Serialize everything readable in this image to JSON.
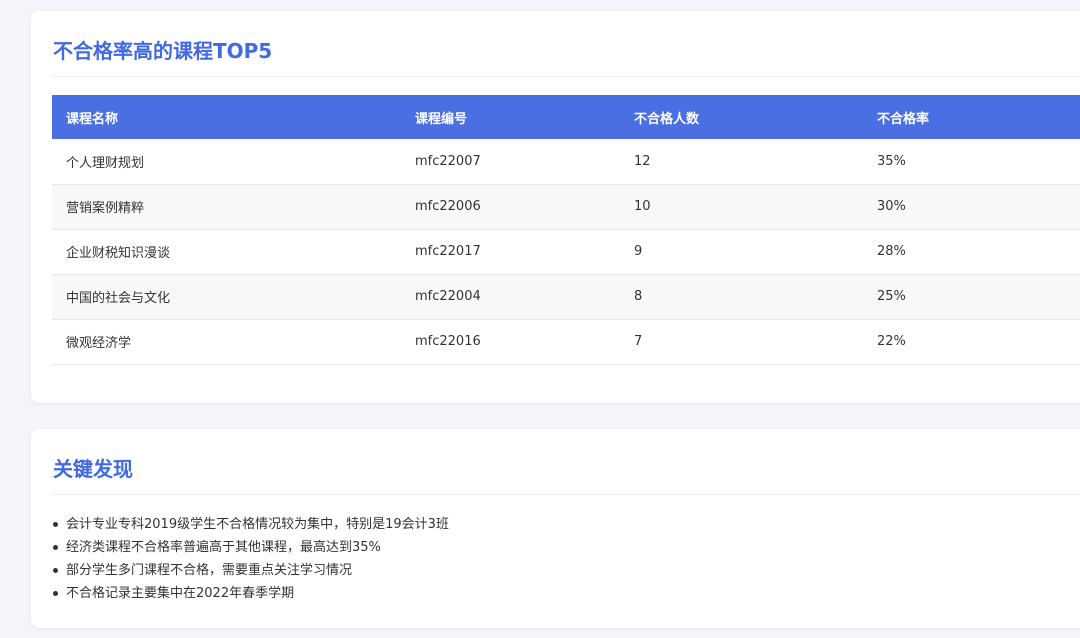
{
  "top_courses": {
    "title": "不合格率高的课程TOP5",
    "columns": [
      "课程名称",
      "课程编号",
      "不合格人数",
      "不合格率"
    ],
    "rows": [
      [
        "个人理财规划",
        "mfc22007",
        "12",
        "35%"
      ],
      [
        "营销案例精粹",
        "mfc22006",
        "10",
        "30%"
      ],
      [
        "企业财税知识漫谈",
        "mfc22017",
        "9",
        "28%"
      ],
      [
        "中国的社会与文化",
        "mfc22004",
        "8",
        "25%"
      ],
      [
        "微观经济学",
        "mfc22016",
        "7",
        "22%"
      ]
    ]
  },
  "findings": {
    "title": "关键发现",
    "items": [
      "会计专业专科2019级学生不合格情况较为集中，特别是19会计3班",
      "经济类课程不合格率普遍高于其他课程，最高达到35%",
      "部分学生多门课程不合格，需要重点关注学习情况",
      "不合格记录主要集中在2022年春季学期"
    ]
  },
  "colors": {
    "accent": "#4169e1",
    "header_bg": "#4a6fe3",
    "page_bg": "#f4f5f9"
  }
}
